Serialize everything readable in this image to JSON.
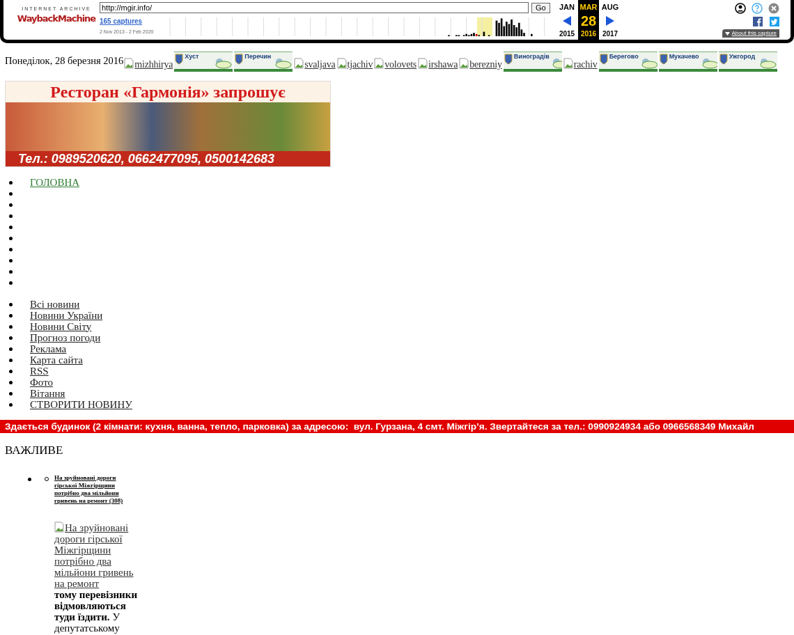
{
  "wayback": {
    "logo_top": "INTERNET ARCHIVE",
    "logo_main": "WaybackMachine",
    "url": "http://mgir.info/",
    "go_button": "Go",
    "captures_link": "165 captures",
    "date_range": "2 Nov 2013 - 2 Feb 2020",
    "months": [
      {
        "label": "JAN",
        "selected": false
      },
      {
        "label": "MAR",
        "selected": true
      },
      {
        "label": "AUG",
        "selected": false
      }
    ],
    "day": "28",
    "years": [
      {
        "label": "2015",
        "selected": false
      },
      {
        "label": "2016",
        "selected": true
      },
      {
        "label": "2017",
        "selected": false
      }
    ],
    "about_button": "About this capture"
  },
  "date_line": "Понеділок, 28 березня 2016",
  "region_links": [
    {
      "kind": "alt",
      "label": "mizhhirya"
    },
    {
      "kind": "banner",
      "label": "Хуст"
    },
    {
      "kind": "banner",
      "label": "Перечин"
    },
    {
      "kind": "alt",
      "label": "svaljava"
    },
    {
      "kind": "alt",
      "label": "tjachiv"
    },
    {
      "kind": "alt",
      "label": "volovets"
    },
    {
      "kind": "alt",
      "label": "irshawa"
    },
    {
      "kind": "alt",
      "label": "berezniy"
    },
    {
      "kind": "banner",
      "label": "Виноградів"
    },
    {
      "kind": "alt",
      "label": "rachiv"
    },
    {
      "kind": "banner",
      "label": "Берегово"
    },
    {
      "kind": "banner",
      "label": "Мукачево"
    },
    {
      "kind": "banner",
      "label": "Ужгород"
    }
  ],
  "ad_banner": {
    "title": "Ресторан «Гармонія» запрошує",
    "phones": "Тел.: 0989520620, 0662477095, 0500142683"
  },
  "main_menu": [
    {
      "kind": "link",
      "label": "ГОЛОВНА"
    },
    {
      "kind": "empty"
    },
    {
      "kind": "empty"
    },
    {
      "kind": "empty"
    },
    {
      "kind": "empty"
    },
    {
      "kind": "empty"
    },
    {
      "kind": "empty"
    },
    {
      "kind": "empty"
    },
    {
      "kind": "empty"
    },
    {
      "kind": "empty"
    }
  ],
  "secondary_menu": [
    "Всі новини",
    "Новини України",
    "Новини Світу",
    "Прогноз погоди",
    "Реклама",
    "Карта сайта",
    "RSS",
    "Фото",
    "Вітання",
    "СТВОРИТИ НОВИНУ"
  ],
  "ticker": "Здається будинок (2 кімнати: кухня, ванна, тепло, парковка) за адресою:  вул. Гурзана, 4 смт. Міжгір’я. Звертайтеся за тел.: 0990924934 або 0966568349 Михайл",
  "important": {
    "heading": "ВАЖЛИВЕ",
    "items": [
      {
        "title": "На зруйновані дороги гірської Міжгірщини потрібно два мільйони гривень на ремонт",
        "count": "(308)",
        "image_alt": "На зруйновані дороги гірської Міжгірщини потрібно два мільйони гривень на ремонт",
        "excerpt": "**тому перевізники відмовляються туди їздити.** У депутатському"
      }
    ]
  }
}
